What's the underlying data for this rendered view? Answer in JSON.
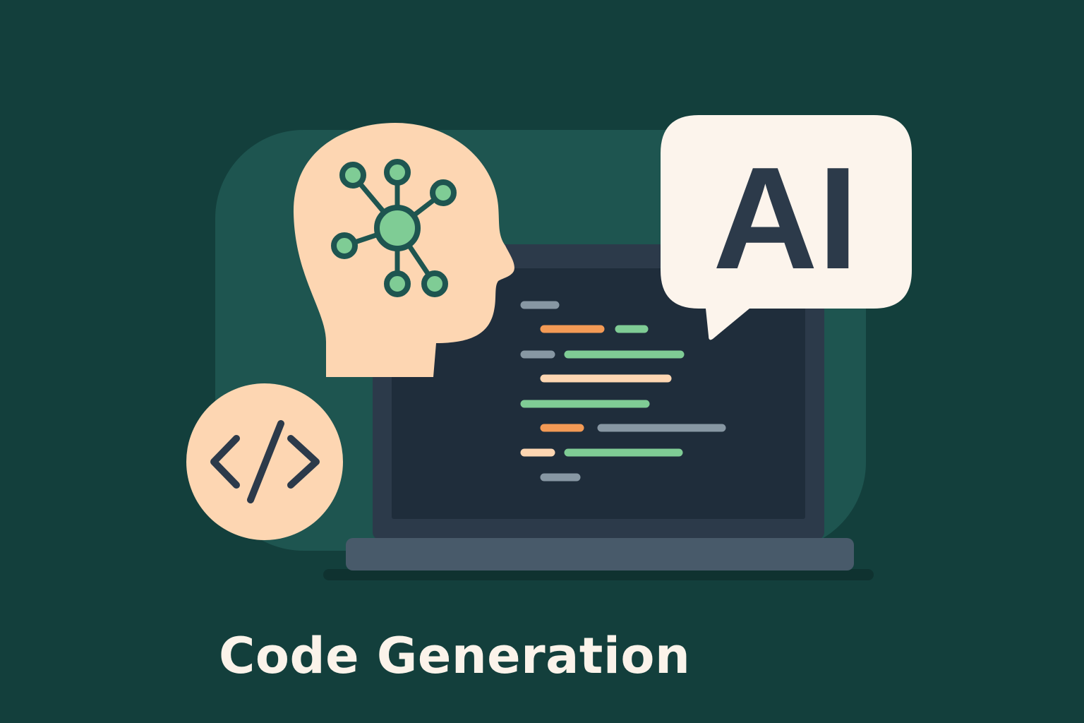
{
  "caption": {
    "title": "Code Generation"
  },
  "speech_bubble": {
    "text": "AI"
  },
  "icons": {
    "head": "ai-head-network-icon",
    "code": "code-brackets-icon",
    "laptop": "laptop-icon",
    "bubble": "speech-bubble-icon"
  },
  "colors": {
    "background": "#133f3c",
    "panel": "#1e5550",
    "skin": "#fdd6b2",
    "dark": "#2c3a4a",
    "screen": "#1f2d3b",
    "laptop_base": "#485a6a",
    "bubble": "#fcf4ec",
    "network_green": "#7fcc95",
    "code_gray": "#8797a3",
    "code_orange": "#f39a55",
    "code_green": "#7fcc95",
    "code_peach": "#fdd6b2",
    "caption": "#fbf3ea"
  }
}
